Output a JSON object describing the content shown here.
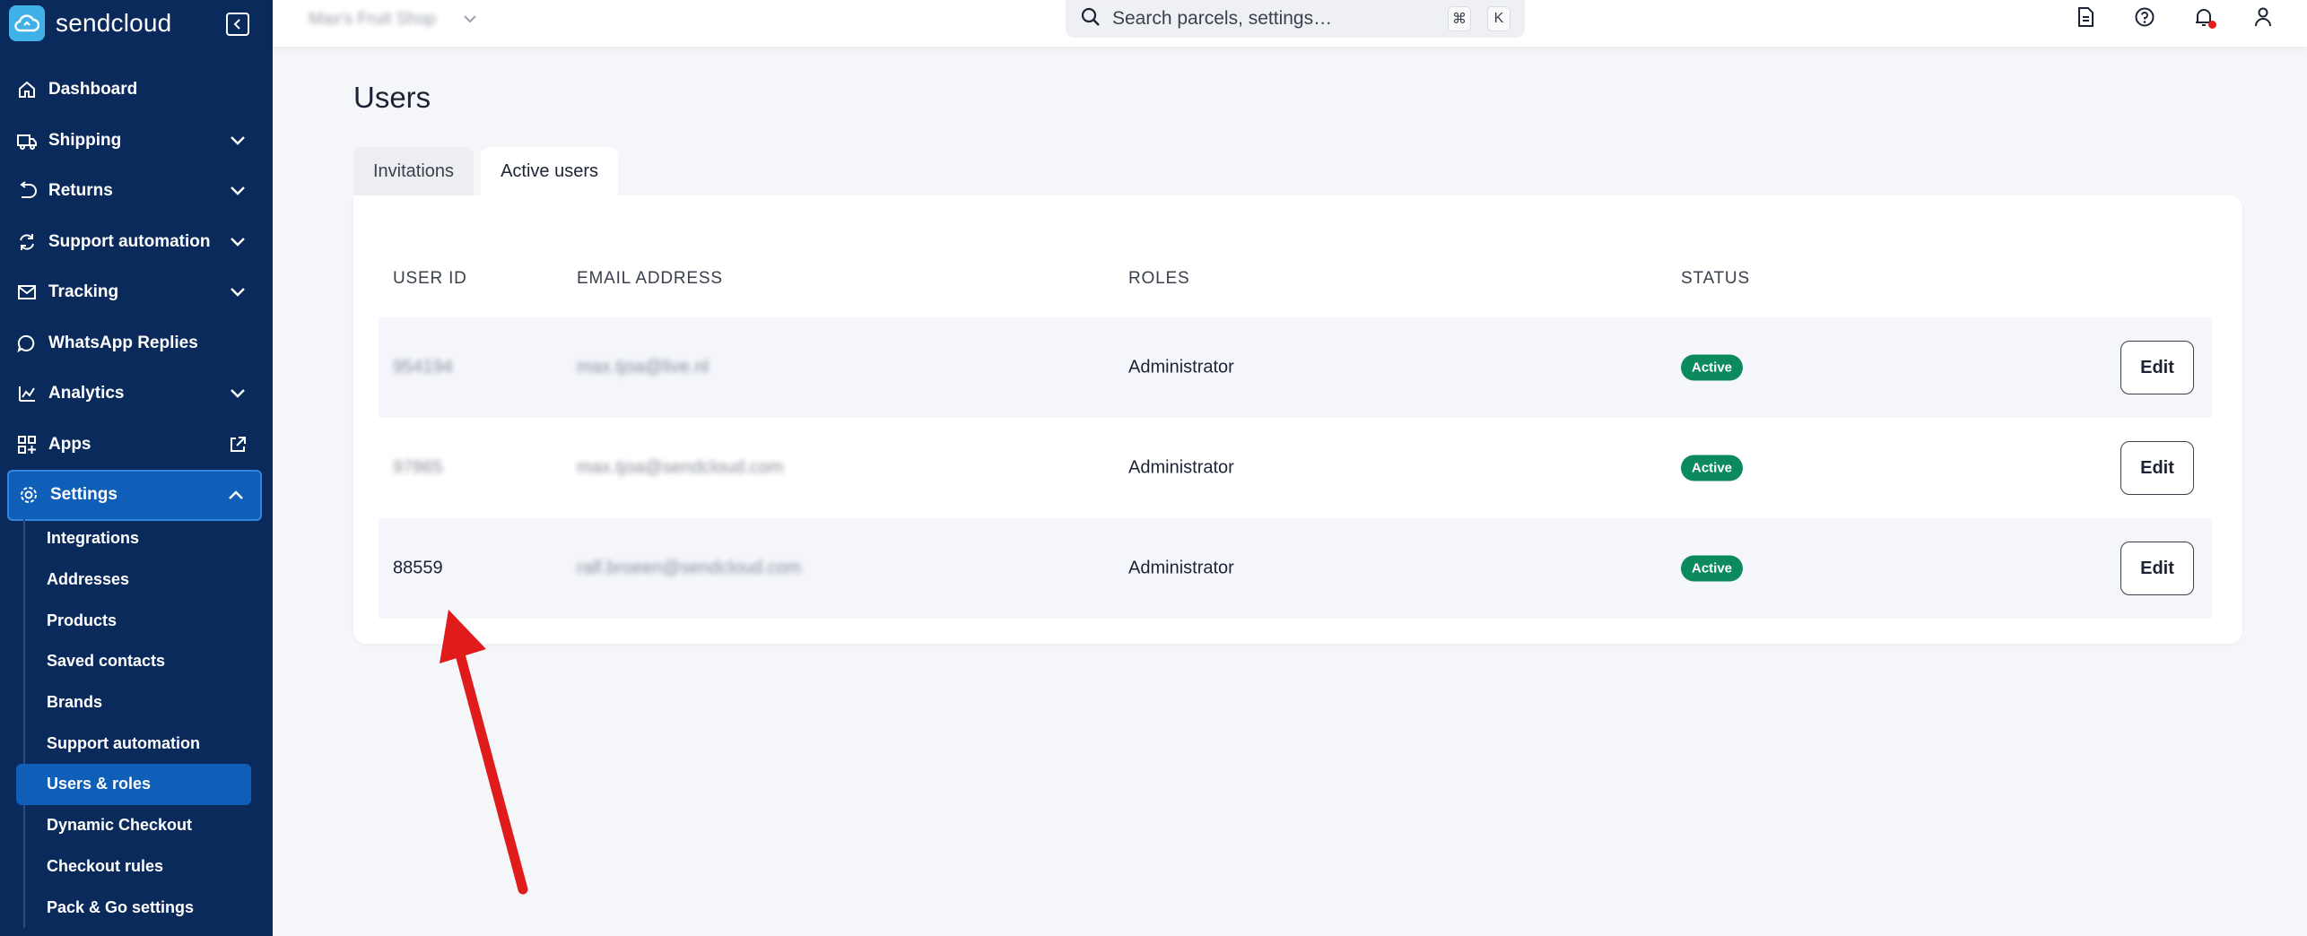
{
  "sidebar": {
    "brand": "sendcloud",
    "items": [
      {
        "label": "Dashboard",
        "icon": "home-icon",
        "expandable": false
      },
      {
        "label": "Shipping",
        "icon": "truck-icon",
        "expandable": true
      },
      {
        "label": "Returns",
        "icon": "return-icon",
        "expandable": true
      },
      {
        "label": "Support automation",
        "icon": "sync-icon",
        "expandable": true
      },
      {
        "label": "Tracking",
        "icon": "mail-icon",
        "expandable": true
      },
      {
        "label": "WhatsApp Replies",
        "icon": "chat-icon",
        "expandable": false
      },
      {
        "label": "Analytics",
        "icon": "chart-icon",
        "expandable": true
      },
      {
        "label": "Apps",
        "icon": "apps-icon",
        "expandable": false
      },
      {
        "label": "Settings",
        "icon": "gear-icon",
        "expandable": true
      }
    ],
    "settings_sub": [
      "Integrations",
      "Addresses",
      "Products",
      "Saved contacts",
      "Brands",
      "Support automation",
      "Users & roles",
      "Dynamic Checkout",
      "Checkout rules",
      "Pack & Go settings"
    ],
    "active_sub": "Users & roles"
  },
  "topbar": {
    "shop_name": "Max's Fruit Shop",
    "search_placeholder": "Search parcels, settings…",
    "shortcut_mod": "⌘",
    "shortcut_key": "K"
  },
  "page": {
    "title": "Users",
    "tabs": [
      "Invitations",
      "Active users"
    ],
    "active_tab": "Active users"
  },
  "table": {
    "headers": [
      "USER ID",
      "EMAIL ADDRESS",
      "ROLES",
      "STATUS"
    ],
    "rows": [
      {
        "user_id": "954194",
        "email": "max.tjoa@live.nl",
        "role": "Administrator",
        "status": "Active",
        "action": "Edit",
        "blurred": true
      },
      {
        "user_id": "97865",
        "email": "max.tjoa@sendcloud.com",
        "role": "Administrator",
        "status": "Active",
        "action": "Edit",
        "blurred": true
      },
      {
        "user_id": "88559",
        "email": "ralf.broeen@sendcloud.com",
        "role": "Administrator",
        "status": "Active",
        "action": "Edit",
        "blurred": false
      }
    ]
  },
  "colors": {
    "sidebar_bg": "#0a2a5c",
    "active_bg": "#0f5fb8",
    "status_green": "#0c8a5e",
    "annotation_arrow": "#e01b1b"
  }
}
